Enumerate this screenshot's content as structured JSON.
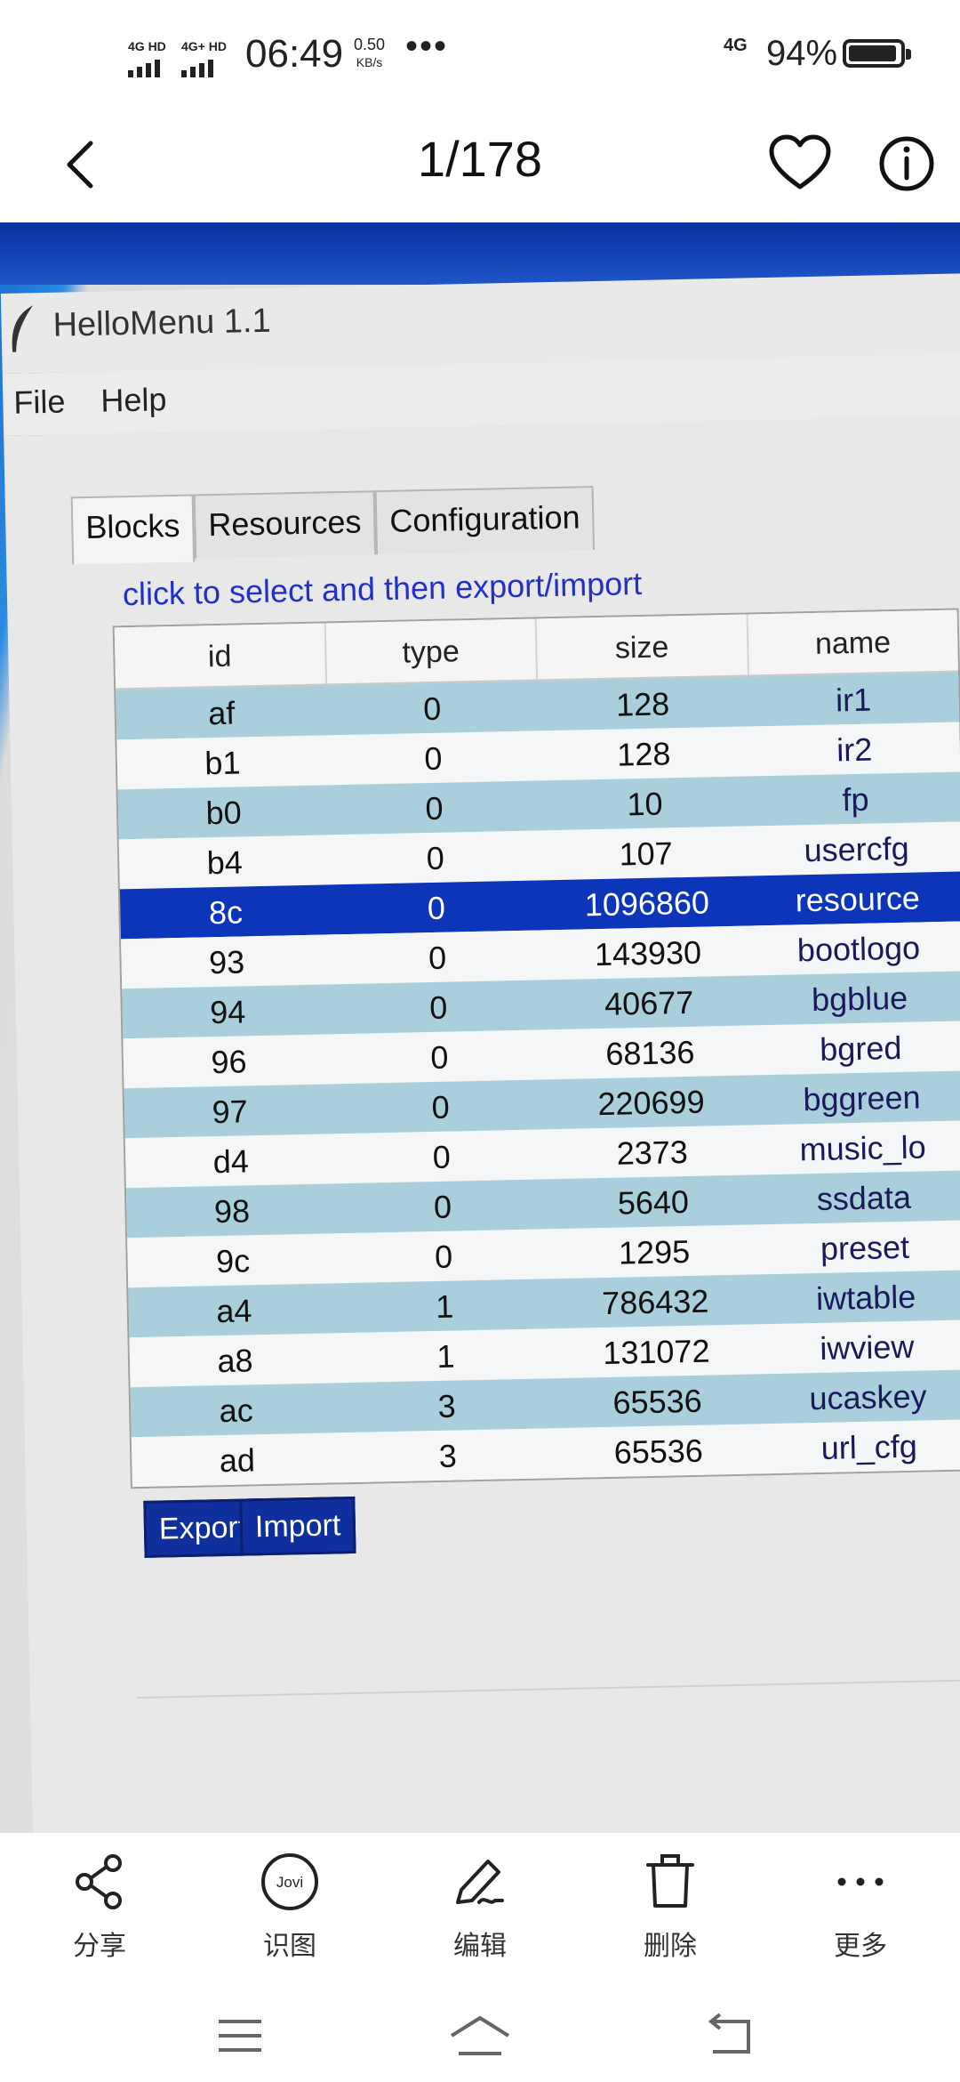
{
  "status_bar": {
    "sim1": "4G HD",
    "sim2": "4G+ HD",
    "time": "06:49",
    "net_speed_value": "0.50",
    "net_speed_unit": "KB/s",
    "more": "•••",
    "sim_right": "4G",
    "battery_percent": "94%",
    "battery_level": 0.94
  },
  "viewer": {
    "counter": "1/178"
  },
  "app_window": {
    "title": "HelloMenu 1.1",
    "menu": [
      "File",
      "Help"
    ],
    "tabs": [
      "Blocks",
      "Resources",
      "Configuration"
    ],
    "active_tab": "Blocks",
    "hint": "click to select and then export/import",
    "table": {
      "columns": [
        "id",
        "type",
        "size",
        "name"
      ],
      "rows": [
        {
          "id": "af",
          "type": "0",
          "size": "128",
          "name": "ir1"
        },
        {
          "id": "b1",
          "type": "0",
          "size": "128",
          "name": "ir2"
        },
        {
          "id": "b0",
          "type": "0",
          "size": "10",
          "name": "fp"
        },
        {
          "id": "b4",
          "type": "0",
          "size": "107",
          "name": "usercfg"
        },
        {
          "id": "8c",
          "type": "0",
          "size": "1096860",
          "name": "resource"
        },
        {
          "id": "93",
          "type": "0",
          "size": "143930",
          "name": "bootlogo"
        },
        {
          "id": "94",
          "type": "0",
          "size": "40677",
          "name": "bgblue"
        },
        {
          "id": "96",
          "type": "0",
          "size": "68136",
          "name": "bgred"
        },
        {
          "id": "97",
          "type": "0",
          "size": "220699",
          "name": "bggreen"
        },
        {
          "id": "d4",
          "type": "0",
          "size": "2373",
          "name": "music_lo"
        },
        {
          "id": "98",
          "type": "0",
          "size": "5640",
          "name": "ssdata"
        },
        {
          "id": "9c",
          "type": "0",
          "size": "1295",
          "name": "preset"
        },
        {
          "id": "a4",
          "type": "1",
          "size": "786432",
          "name": "iwtable"
        },
        {
          "id": "a8",
          "type": "1",
          "size": "131072",
          "name": "iwview"
        },
        {
          "id": "ac",
          "type": "3",
          "size": "65536",
          "name": "ucaskey"
        },
        {
          "id": "ad",
          "type": "3",
          "size": "65536",
          "name": "url_cfg"
        }
      ],
      "selected_id": "8c"
    },
    "buttons": {
      "export": "Export",
      "import": "Import"
    }
  },
  "actions": [
    {
      "label": "分享",
      "icon": "share-icon"
    },
    {
      "label": "识图",
      "icon": "jovi-icon",
      "icon_text": "Jovi"
    },
    {
      "label": "编辑",
      "icon": "edit-icon"
    },
    {
      "label": "删除",
      "icon": "delete-icon"
    },
    {
      "label": "更多",
      "icon": "more-icon"
    }
  ],
  "colors": {
    "selected_row": "#0c35b9",
    "band_row": "#a9cfdc",
    "button": "#0f2f9c",
    "hint_text": "#2230c8"
  }
}
